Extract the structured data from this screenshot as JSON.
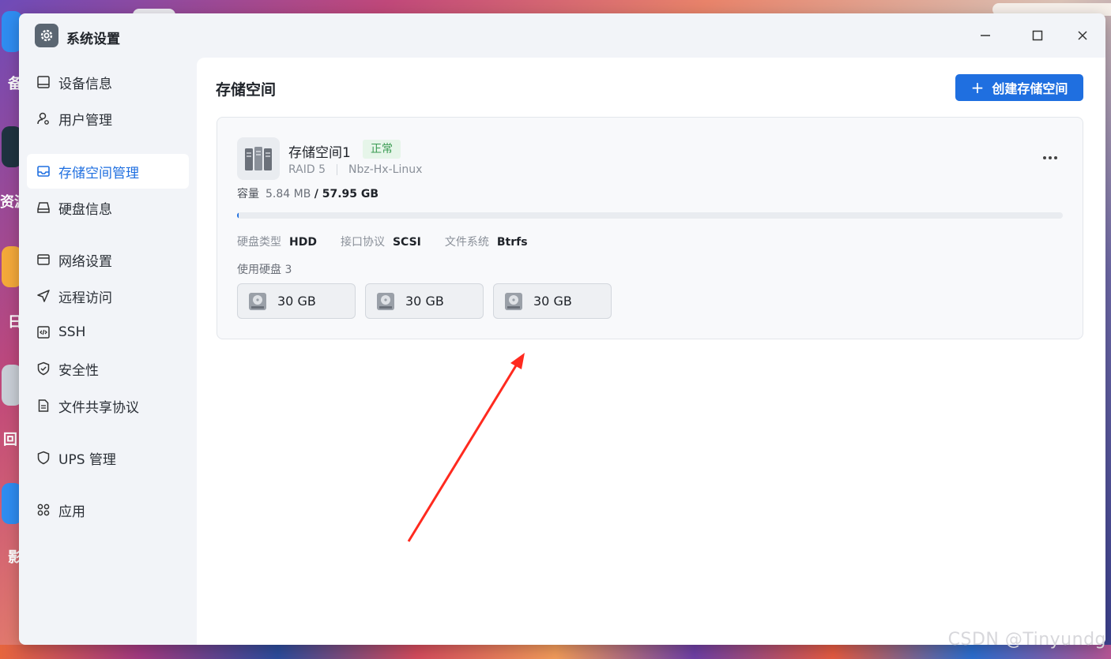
{
  "window": {
    "title": "系统设置",
    "controls": [
      "minimize",
      "maximize",
      "close"
    ]
  },
  "desktop": {
    "labels": [
      "备",
      "资源",
      "日",
      "回",
      "影"
    ],
    "watermark": "CSDN @Tinyundg"
  },
  "sidebar": {
    "items": [
      {
        "label": "设备信息",
        "icon": "device-icon",
        "active": false
      },
      {
        "label": "用户管理",
        "icon": "user-gear-icon",
        "active": false
      },
      {
        "label": "存储空间管理",
        "icon": "storage-icon",
        "active": true
      },
      {
        "label": "硬盘信息",
        "icon": "disk-icon",
        "active": false
      },
      {
        "label": "网络设置",
        "icon": "network-icon",
        "active": false
      },
      {
        "label": "远程访问",
        "icon": "send-icon",
        "active": false
      },
      {
        "label": "SSH",
        "icon": "code-icon",
        "active": false
      },
      {
        "label": "安全性",
        "icon": "shield-check-icon",
        "active": false
      },
      {
        "label": "文件共享协议",
        "icon": "file-icon",
        "active": false
      },
      {
        "label": "UPS 管理",
        "icon": "shield-icon",
        "active": false
      },
      {
        "label": "应用",
        "icon": "apps-icon",
        "active": false
      }
    ]
  },
  "main": {
    "title": "存储空间",
    "create_button": "创建存储空间",
    "volume": {
      "name": "存储空间1",
      "status": "正常",
      "raid": "RAID 5",
      "host": "Nbz-Hx-Linux",
      "capacity_label": "容量",
      "used": "5.84 MB",
      "total": "/ 57.95 GB",
      "usage_fraction": 0.0001,
      "specs": [
        {
          "key": "硬盘类型",
          "value": "HDD"
        },
        {
          "key": "接口协议",
          "value": "SCSI"
        },
        {
          "key": "文件系统",
          "value": "Btrfs"
        }
      ],
      "disks_label": "使用硬盘 3",
      "disks": [
        {
          "size": "30 GB"
        },
        {
          "size": "30 GB"
        },
        {
          "size": "30 GB"
        }
      ]
    }
  },
  "colors": {
    "accent": "#1f6fe0",
    "status_green": "#3a9b52",
    "annotation_arrow": "#ff2a1f"
  }
}
